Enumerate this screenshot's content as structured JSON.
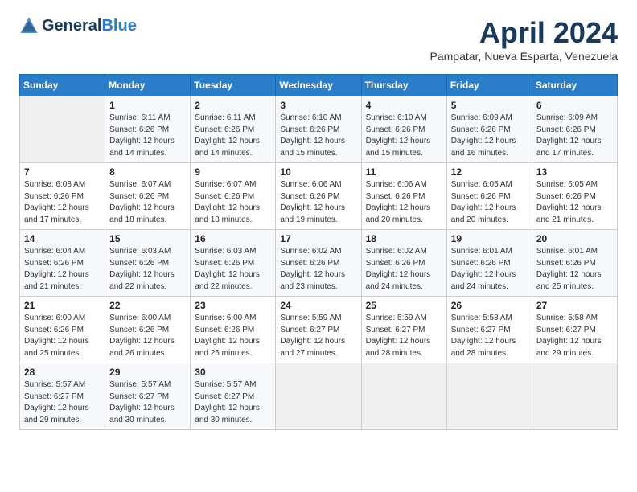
{
  "header": {
    "logo_general": "General",
    "logo_blue": "Blue",
    "title": "April 2024",
    "subtitle": "Pampatar, Nueva Esparta, Venezuela"
  },
  "days_of_week": [
    "Sunday",
    "Monday",
    "Tuesday",
    "Wednesday",
    "Thursday",
    "Friday",
    "Saturday"
  ],
  "weeks": [
    [
      {
        "day": "",
        "sunrise": "",
        "sunset": "",
        "daylight": ""
      },
      {
        "day": "1",
        "sunrise": "6:11 AM",
        "sunset": "6:26 PM",
        "daylight": "12 hours and 14 minutes."
      },
      {
        "day": "2",
        "sunrise": "6:11 AM",
        "sunset": "6:26 PM",
        "daylight": "12 hours and 14 minutes."
      },
      {
        "day": "3",
        "sunrise": "6:10 AM",
        "sunset": "6:26 PM",
        "daylight": "12 hours and 15 minutes."
      },
      {
        "day": "4",
        "sunrise": "6:10 AM",
        "sunset": "6:26 PM",
        "daylight": "12 hours and 15 minutes."
      },
      {
        "day": "5",
        "sunrise": "6:09 AM",
        "sunset": "6:26 PM",
        "daylight": "12 hours and 16 minutes."
      },
      {
        "day": "6",
        "sunrise": "6:09 AM",
        "sunset": "6:26 PM",
        "daylight": "12 hours and 17 minutes."
      }
    ],
    [
      {
        "day": "7",
        "sunrise": "6:08 AM",
        "sunset": "6:26 PM",
        "daylight": "12 hours and 17 minutes."
      },
      {
        "day": "8",
        "sunrise": "6:07 AM",
        "sunset": "6:26 PM",
        "daylight": "12 hours and 18 minutes."
      },
      {
        "day": "9",
        "sunrise": "6:07 AM",
        "sunset": "6:26 PM",
        "daylight": "12 hours and 18 minutes."
      },
      {
        "day": "10",
        "sunrise": "6:06 AM",
        "sunset": "6:26 PM",
        "daylight": "12 hours and 19 minutes."
      },
      {
        "day": "11",
        "sunrise": "6:06 AM",
        "sunset": "6:26 PM",
        "daylight": "12 hours and 20 minutes."
      },
      {
        "day": "12",
        "sunrise": "6:05 AM",
        "sunset": "6:26 PM",
        "daylight": "12 hours and 20 minutes."
      },
      {
        "day": "13",
        "sunrise": "6:05 AM",
        "sunset": "6:26 PM",
        "daylight": "12 hours and 21 minutes."
      }
    ],
    [
      {
        "day": "14",
        "sunrise": "6:04 AM",
        "sunset": "6:26 PM",
        "daylight": "12 hours and 21 minutes."
      },
      {
        "day": "15",
        "sunrise": "6:03 AM",
        "sunset": "6:26 PM",
        "daylight": "12 hours and 22 minutes."
      },
      {
        "day": "16",
        "sunrise": "6:03 AM",
        "sunset": "6:26 PM",
        "daylight": "12 hours and 22 minutes."
      },
      {
        "day": "17",
        "sunrise": "6:02 AM",
        "sunset": "6:26 PM",
        "daylight": "12 hours and 23 minutes."
      },
      {
        "day": "18",
        "sunrise": "6:02 AM",
        "sunset": "6:26 PM",
        "daylight": "12 hours and 24 minutes."
      },
      {
        "day": "19",
        "sunrise": "6:01 AM",
        "sunset": "6:26 PM",
        "daylight": "12 hours and 24 minutes."
      },
      {
        "day": "20",
        "sunrise": "6:01 AM",
        "sunset": "6:26 PM",
        "daylight": "12 hours and 25 minutes."
      }
    ],
    [
      {
        "day": "21",
        "sunrise": "6:00 AM",
        "sunset": "6:26 PM",
        "daylight": "12 hours and 25 minutes."
      },
      {
        "day": "22",
        "sunrise": "6:00 AM",
        "sunset": "6:26 PM",
        "daylight": "12 hours and 26 minutes."
      },
      {
        "day": "23",
        "sunrise": "6:00 AM",
        "sunset": "6:26 PM",
        "daylight": "12 hours and 26 minutes."
      },
      {
        "day": "24",
        "sunrise": "5:59 AM",
        "sunset": "6:27 PM",
        "daylight": "12 hours and 27 minutes."
      },
      {
        "day": "25",
        "sunrise": "5:59 AM",
        "sunset": "6:27 PM",
        "daylight": "12 hours and 28 minutes."
      },
      {
        "day": "26",
        "sunrise": "5:58 AM",
        "sunset": "6:27 PM",
        "daylight": "12 hours and 28 minutes."
      },
      {
        "day": "27",
        "sunrise": "5:58 AM",
        "sunset": "6:27 PM",
        "daylight": "12 hours and 29 minutes."
      }
    ],
    [
      {
        "day": "28",
        "sunrise": "5:57 AM",
        "sunset": "6:27 PM",
        "daylight": "12 hours and 29 minutes."
      },
      {
        "day": "29",
        "sunrise": "5:57 AM",
        "sunset": "6:27 PM",
        "daylight": "12 hours and 30 minutes."
      },
      {
        "day": "30",
        "sunrise": "5:57 AM",
        "sunset": "6:27 PM",
        "daylight": "12 hours and 30 minutes."
      },
      {
        "day": "",
        "sunrise": "",
        "sunset": "",
        "daylight": ""
      },
      {
        "day": "",
        "sunrise": "",
        "sunset": "",
        "daylight": ""
      },
      {
        "day": "",
        "sunrise": "",
        "sunset": "",
        "daylight": ""
      },
      {
        "day": "",
        "sunrise": "",
        "sunset": "",
        "daylight": ""
      }
    ]
  ],
  "labels": {
    "sunrise_prefix": "Sunrise: ",
    "sunset_prefix": "Sunset: ",
    "daylight_prefix": "Daylight: "
  }
}
